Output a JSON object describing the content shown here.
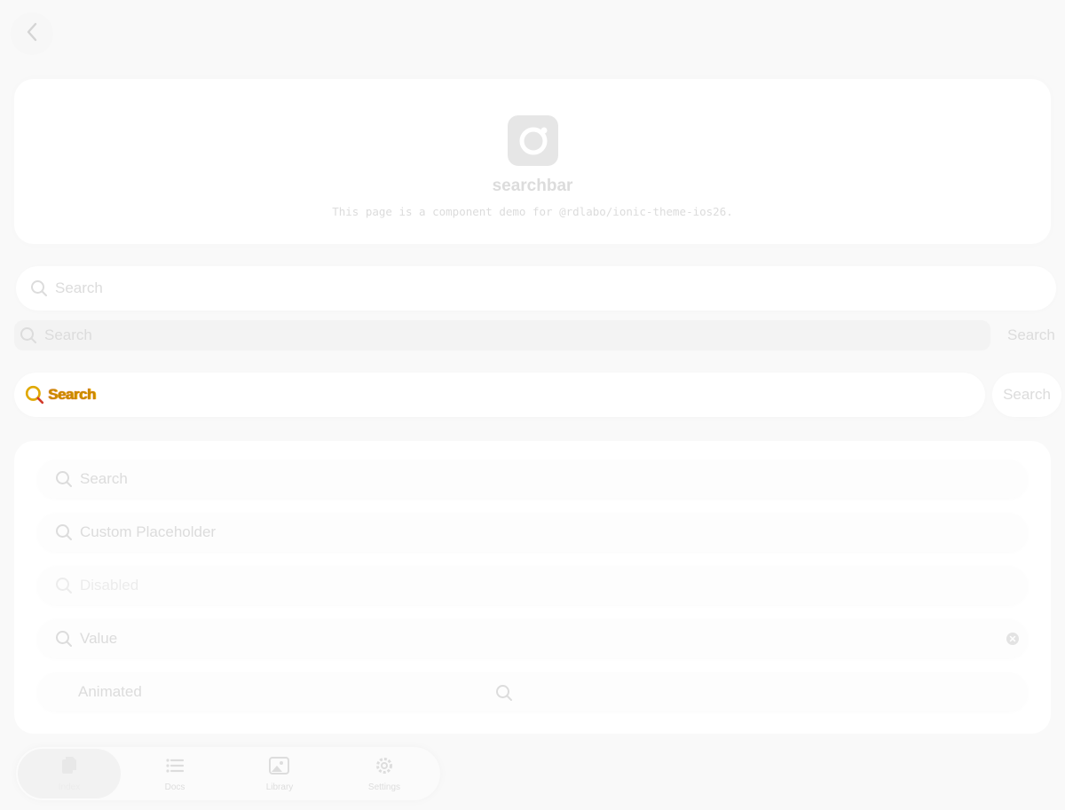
{
  "header": {
    "back_label": ""
  },
  "hero": {
    "title": "searchbar",
    "subtitle": "This page is a component demo for @rdlabo/ionic-theme-ios26."
  },
  "searchbars": {
    "default_placeholder": "Search",
    "cancel_plain_placeholder": "Search",
    "cancel_plain_label": "Search",
    "colored_placeholder": "Search",
    "cancel_pill_label": "Search"
  },
  "list": {
    "rows": [
      {
        "placeholder": "Search"
      },
      {
        "placeholder": "Custom Placeholder"
      },
      {
        "placeholder": "Disabled"
      },
      {
        "value": "Value"
      },
      {
        "placeholder": "Animated"
      }
    ]
  },
  "tabs": [
    {
      "label": "Index",
      "icon": "documents-icon",
      "selected": true
    },
    {
      "label": "Docs",
      "icon": "list-icon"
    },
    {
      "label": "Library",
      "icon": "images-icon"
    },
    {
      "label": "Settings",
      "icon": "gear-icon"
    }
  ],
  "colors": {
    "background": "#f9f9f9",
    "card": "#ffffff",
    "muted_text": "#dcdcdc",
    "highlight_text": "#c78a00"
  }
}
